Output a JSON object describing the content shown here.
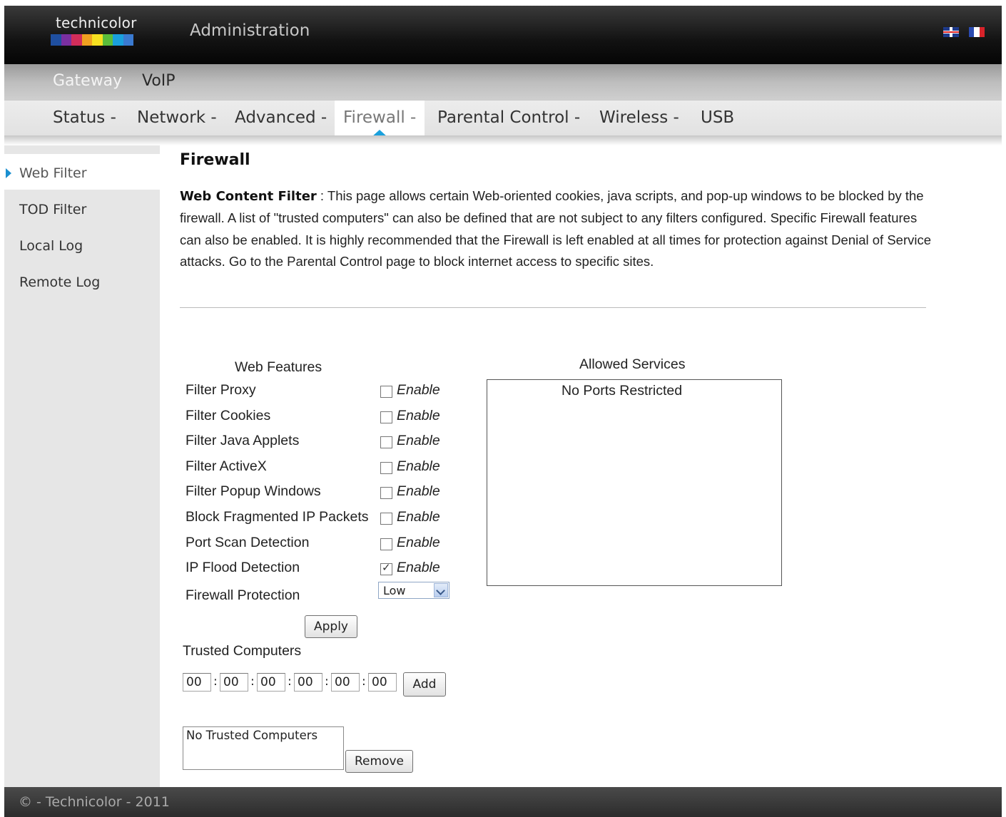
{
  "header": {
    "logo_text": "technicolor",
    "title": "Administration",
    "logo_colors": [
      "#1f4fa0",
      "#7a2fa0",
      "#d22d5a",
      "#f0a020",
      "#f6e020",
      "#5bbd3a",
      "#1aa0dc",
      "#3a7ad0"
    ],
    "flag_icons": [
      "uk-flag-icon",
      "france-flag-icon"
    ]
  },
  "subnav": {
    "gateway": "Gateway",
    "voip": "VoIP"
  },
  "mainnav": {
    "items": [
      "Status -",
      "Network -",
      "Advanced -",
      "Firewall -",
      "Parental Control -",
      "Wireless -",
      "USB"
    ],
    "active": "Firewall -"
  },
  "sidebar": {
    "items": [
      "Web Filter",
      "TOD Filter",
      "Local Log",
      "Remote Log"
    ],
    "active": "Web Filter"
  },
  "content": {
    "title": "Firewall",
    "desc_label": "Web Content Filter",
    "desc_sep": " : ",
    "desc_text": "This page allows certain Web-oriented cookies, java scripts, and pop-up windows to be blocked by the firewall. A list of \"trusted computers\" can also be defined that are not subject to any filters configured. Specific Firewall features can also be enabled. It is highly recommended that the Firewall is left enabled at all times for protection against Denial of Service attacks. Go to the Parental Control page to block internet access to specific sites."
  },
  "web_features": {
    "title": "Web Features",
    "enable_label": "Enable",
    "features": [
      {
        "label": "Filter Proxy",
        "checked": false
      },
      {
        "label": "Filter Cookies",
        "checked": false
      },
      {
        "label": "Filter Java Applets",
        "checked": false
      },
      {
        "label": "Filter ActiveX",
        "checked": false
      },
      {
        "label": "Filter Popup Windows",
        "checked": false
      },
      {
        "label": "Block Fragmented IP Packets",
        "checked": false
      },
      {
        "label": "Port Scan Detection",
        "checked": false
      },
      {
        "label": "IP Flood Detection",
        "checked": true
      }
    ],
    "protection_label": "Firewall Protection",
    "protection_value": "Low",
    "apply_label": "Apply"
  },
  "trusted": {
    "title": "Trusted Computers",
    "mac": [
      "00",
      "00",
      "00",
      "00",
      "00",
      "00"
    ],
    "separator": ":",
    "add_label": "Add",
    "list_text": "No Trusted Computers",
    "remove_label": "Remove"
  },
  "allowed": {
    "title": "Allowed Services",
    "text": "No Ports Restricted"
  },
  "footer": {
    "text": "© - Technicolor - 2011"
  },
  "colors": {
    "accent": "#1aa0dc",
    "flag_blue": "#2b4bb0",
    "flag_white": "#ffffff",
    "flag_red": "#d8232a"
  }
}
